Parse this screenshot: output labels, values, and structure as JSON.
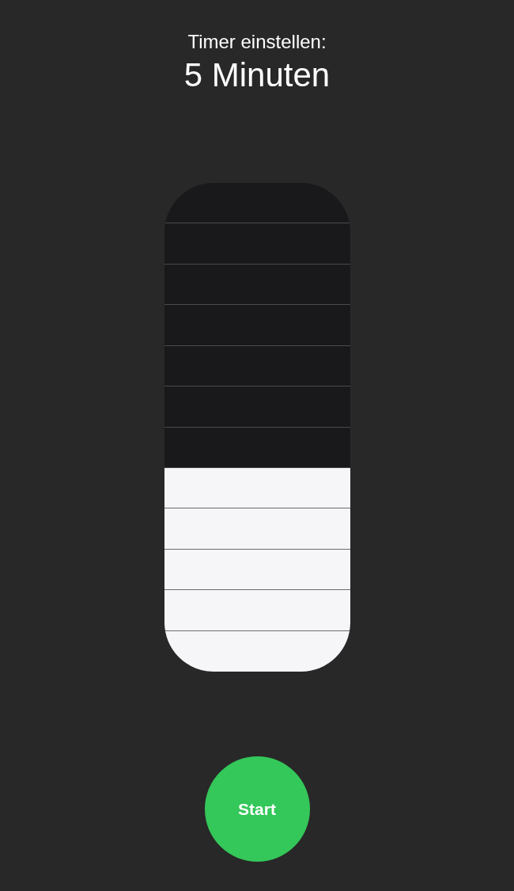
{
  "header": {
    "label": "Timer einstellen:",
    "value": "5 Minuten"
  },
  "slider": {
    "level": 0.4167
  },
  "start_button": {
    "label": "Start"
  }
}
